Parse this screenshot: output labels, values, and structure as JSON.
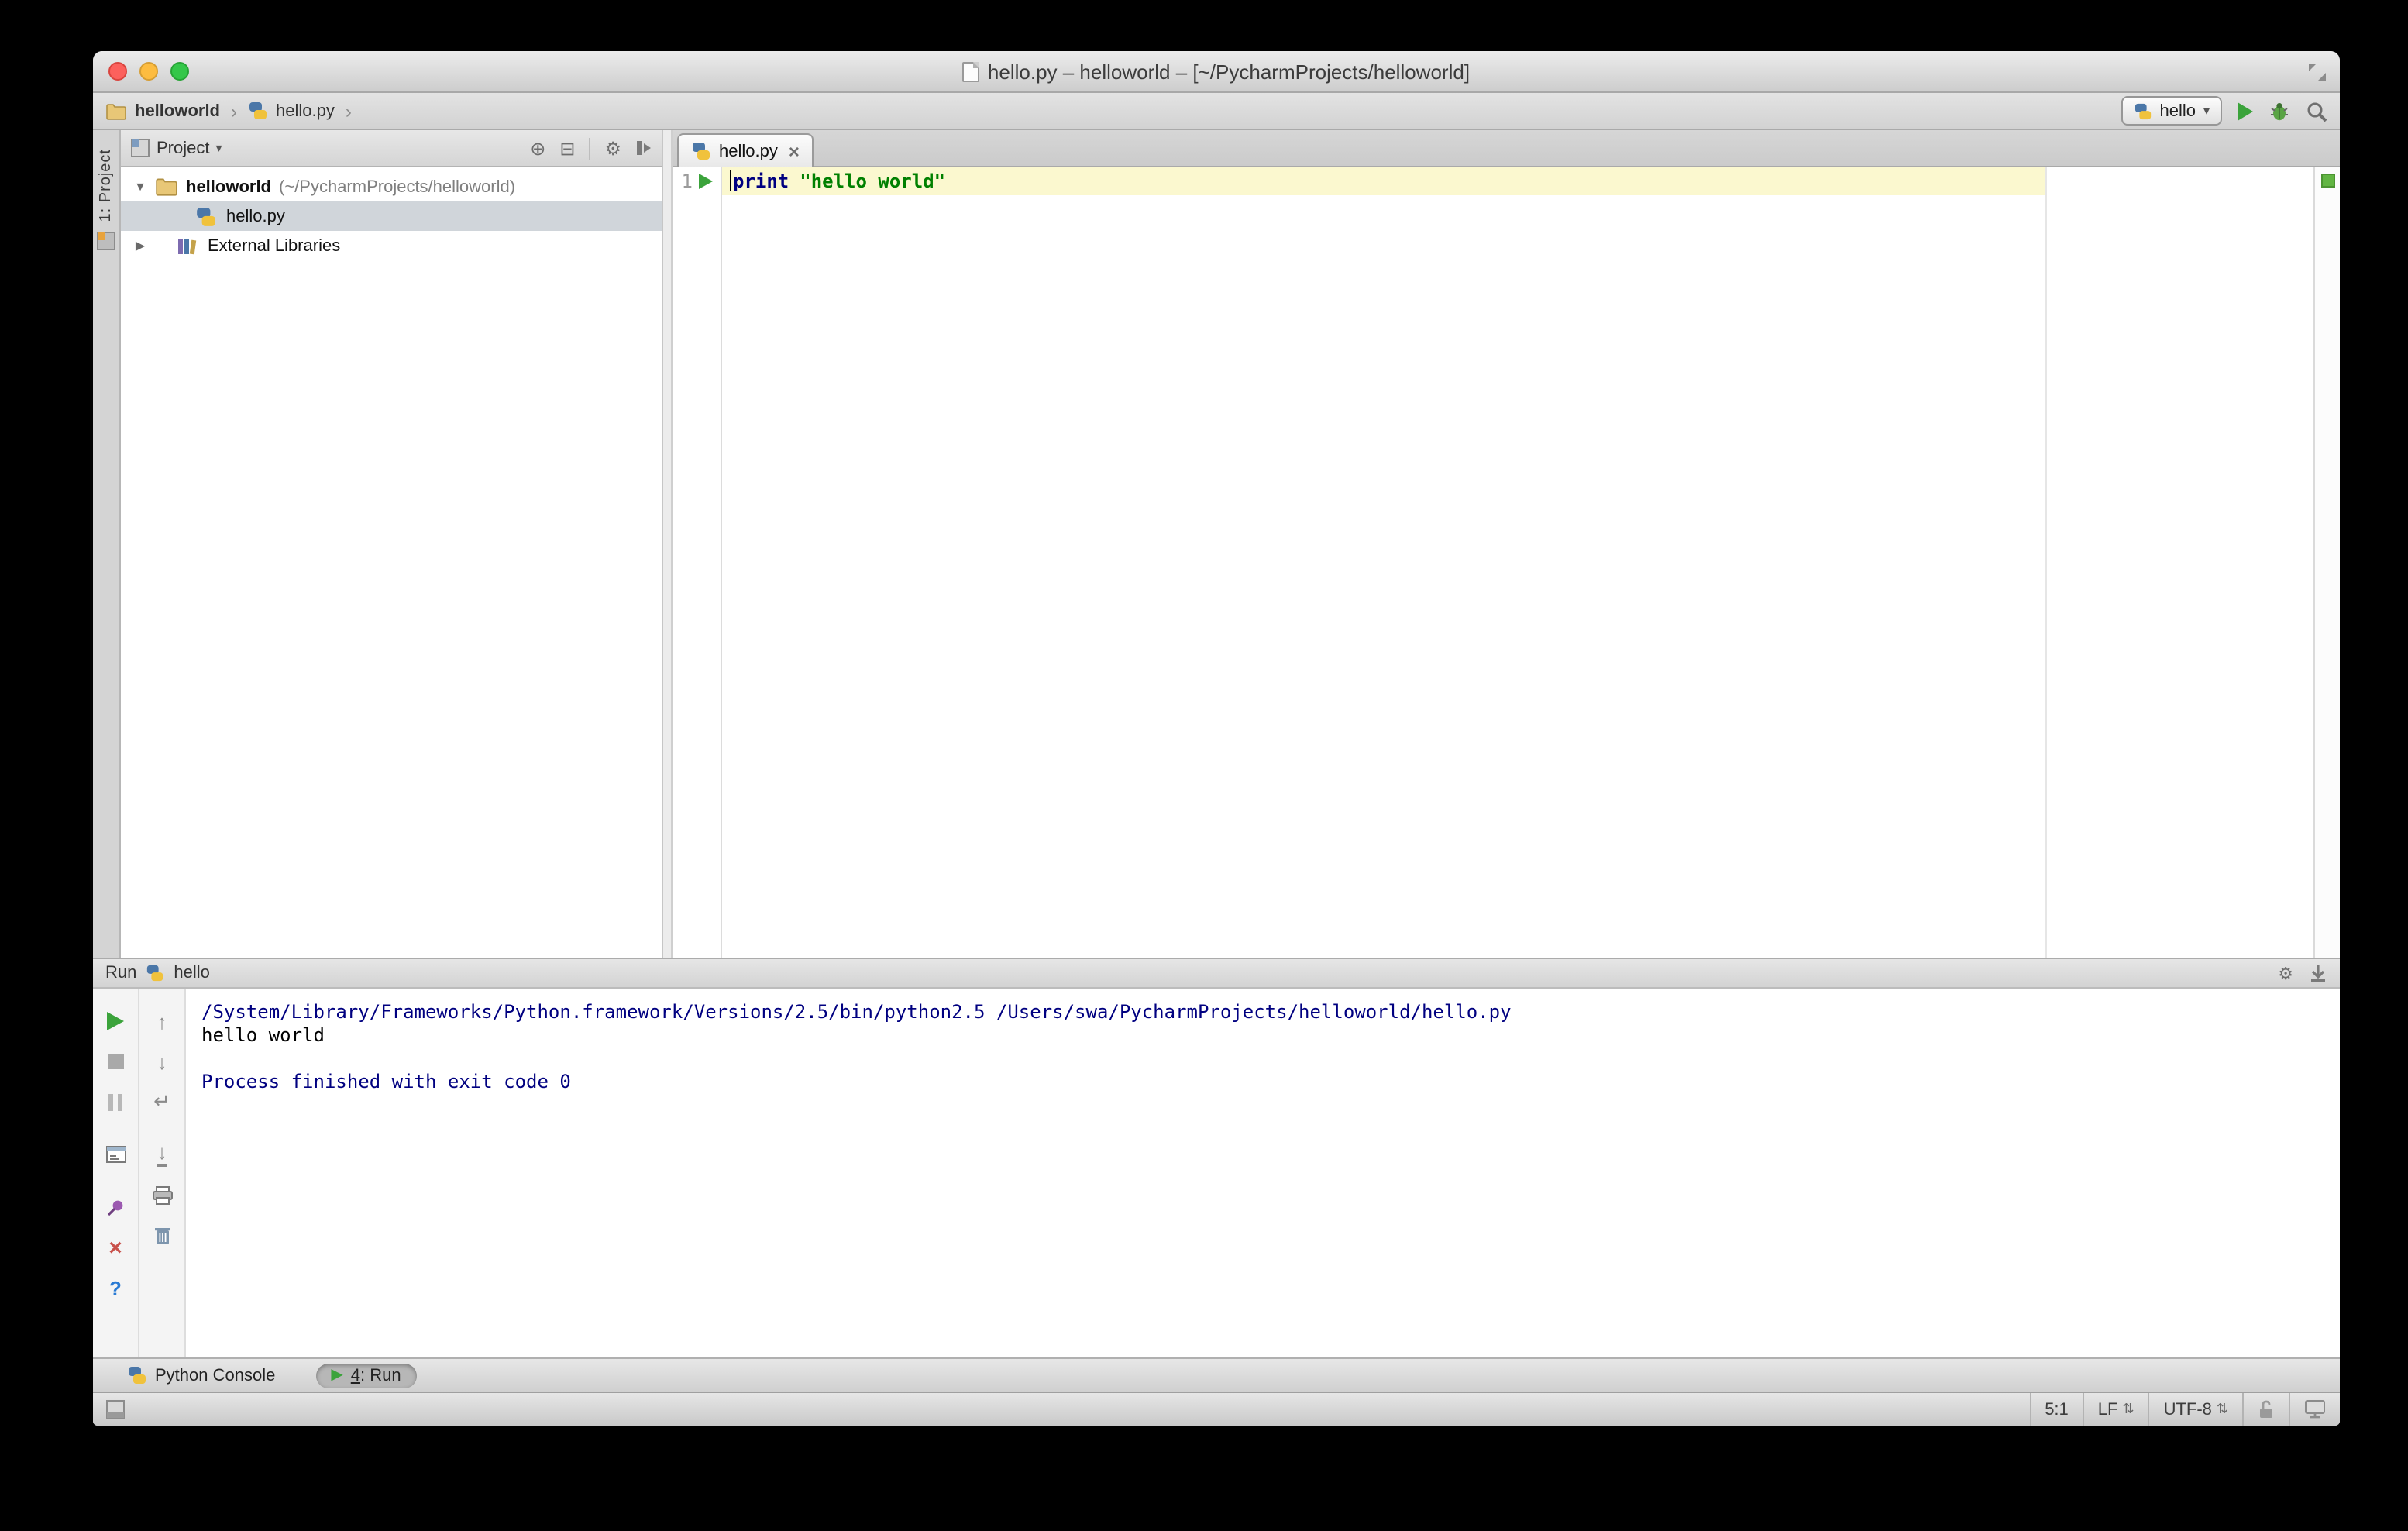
{
  "window": {
    "title": "hello.py – helloworld – [~/PycharmProjects/helloworld]"
  },
  "navbar": {
    "breadcrumb": {
      "project": "helloworld",
      "file": "hello.py"
    },
    "run_config_label": "hello"
  },
  "left_toolbar": {
    "project_button_label": "1: Project"
  },
  "project_panel": {
    "header_label": "Project",
    "tree": {
      "root_label": "helloworld",
      "root_path": "(~/PycharmProjects/helloworld)",
      "file_label": "hello.py",
      "external_libraries_label": "External Libraries"
    }
  },
  "editor": {
    "tab_label": "hello.py",
    "line_number": "1",
    "code_tokens": {
      "keyword": "print",
      "string": "\"hello world\""
    }
  },
  "run_panel": {
    "header_label": "Run",
    "config_label": "hello",
    "console_lines": [
      {
        "text": "/System/Library/Frameworks/Python.framework/Versions/2.5/bin/python2.5 /Users/swa/PycharmProjects/helloworld/hello.py",
        "kind": "system"
      },
      {
        "text": "hello world",
        "kind": "stdout"
      },
      {
        "text": "",
        "kind": "stdout"
      },
      {
        "text": "Process finished with exit code 0",
        "kind": "system"
      }
    ]
  },
  "bottom_bar": {
    "python_console_label": "Python Console",
    "run_tab_number": "4",
    "run_tab_suffix": ": Run"
  },
  "status_bar": {
    "caret_position": "5:1",
    "line_separator": "LF",
    "encoding": "UTF-8"
  },
  "icons": {
    "chevron_separator": "›",
    "dropdown_arrow": "▾",
    "tree_expanded": "▼",
    "tree_collapsed": "▶",
    "stop": "■",
    "up_arrow": "↑",
    "down_arrow": "↓",
    "close": "×",
    "help": "?",
    "gear": "⚙",
    "locate": "⊕",
    "collapse_all": "⊟",
    "soft_wrap": "↵",
    "scroll_to_end": "↓",
    "updown": "⇅",
    "play_bottom": "▶"
  },
  "colors": {
    "run_green": "#3BA33B",
    "keyword_color": "#000080",
    "string_color": "#008000",
    "console_system_color": "#000080",
    "console_stdout_color": "#000000",
    "caret_row_color": "#FBF8CF",
    "annotation_ok_color": "#62B543",
    "selection_bg": "#D0D5DA"
  }
}
